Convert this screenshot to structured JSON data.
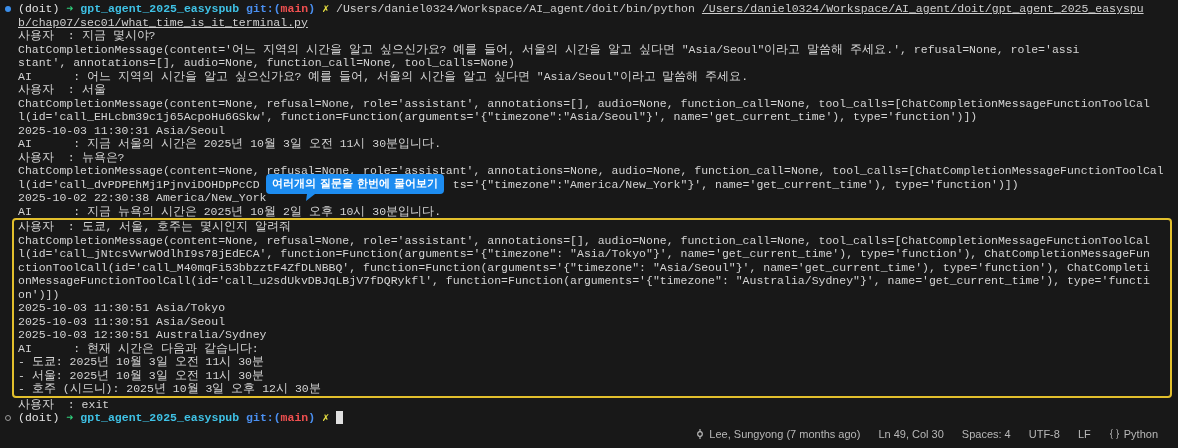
{
  "terminal": {
    "rows_before": [
      {
        "kind": "prompt",
        "status_dot_filled": true,
        "segments": [
          {
            "kind": "env",
            "text": "(doit)"
          },
          {
            "kind": "arrow",
            "text": "➜"
          },
          {
            "kind": "dir",
            "text": "gpt_agent_2025_easyspub"
          },
          {
            "kind": "git",
            "text": "git:("
          },
          {
            "kind": "branch",
            "text": "main"
          },
          {
            "kind": "git",
            "text": ")"
          },
          {
            "kind": "dirty",
            "text": "✗"
          },
          {
            "kind": "path",
            "text": "/Users/daniel0324/Workspace/AI_agent/doit/bin/python"
          },
          {
            "kind": "link",
            "text": "/Users/daniel0324/Workspace/AI_agent/doit/gpt_agent_2025_easyspu"
          }
        ]
      },
      {
        "kind": "text",
        "segments": [
          {
            "kind": "link",
            "text": "b/chap07/sec01/what_time_is_it_terminal.py"
          }
        ]
      },
      {
        "kind": "text",
        "text": "사용자  : 지금 몇시야?"
      },
      {
        "kind": "text",
        "text": "ChatCompletionMessage(content='어느 지역의 시간을 알고 싶으신가요? 예를 들어, 서울의 시간을 알고 싶다면 \"Asia/Seoul\"이라고 말씀해 주세요.', refusal=None, role='assi"
      },
      {
        "kind": "text",
        "text": "stant', annotations=[], audio=None, function_call=None, tool_calls=None)"
      },
      {
        "kind": "text",
        "text": "AI      : 어느 지역의 시간을 알고 싶으신가요? 예를 들어, 서울의 시간을 알고 싶다면 \"Asia/Seoul\"이라고 말씀해 주세요."
      },
      {
        "kind": "text",
        "text": "사용자  : 서울"
      },
      {
        "kind": "text",
        "text": "ChatCompletionMessage(content=None, refusal=None, role='assistant', annotations=[], audio=None, function_call=None, tool_calls=[ChatCompletionMessageFunctionToolCal"
      },
      {
        "kind": "text",
        "text": "l(id='call_EHLcbm39c1j65AcpoHu6GSkw', function=Function(arguments='{\"timezone\":\"Asia/Seoul\"}', name='get_current_time'), type='function')])"
      },
      {
        "kind": "text",
        "text": "2025-10-03 11:30:31 Asia/Seoul"
      },
      {
        "kind": "text",
        "text": "AI      : 지금 서울의 시간은 2025년 10월 3일 오전 11시 30분입니다."
      },
      {
        "kind": "text",
        "text": "사용자  : 뉴욕은?"
      },
      {
        "kind": "text",
        "text": "ChatCompletionMessage(content=None, refusal=None, role='assistant', annotations=None, audio=None, function_call=None, tool_calls=[ChatCompletionMessageFunctionToolCal"
      },
      {
        "kind": "split",
        "left": "l(id='call_dvPDPEhMj1PjnviDOHDpPcCD",
        "right": "ts='{\"timezone\":\"America/New_York\"}', name='get_current_time'), type='function')])"
      },
      {
        "kind": "text",
        "text": "2025-10-02 22:30:38 America/New_York"
      },
      {
        "kind": "text",
        "text": "AI      : 지금 뉴욕의 시간은 2025년 10월 2일 오후 10시 30분입니다."
      }
    ],
    "highlight_box": {
      "rows": [
        {
          "kind": "text",
          "text": "사용자  : 도쿄, 서울, 호주는 몇시인지 알려줘"
        },
        {
          "kind": "text",
          "text": "ChatCompletionMessage(content=None, refusal=None, role='assistant', annotations=[], audio=None, function_call=None, tool_calls=[ChatCompletionMessageFunctionToolCal"
        },
        {
          "kind": "text",
          "text": "l(id='call_jNtcsVwrWOdlhI9s78jEdECA', function=Function(arguments='{\"timezone\": \"Asia/Tokyo\"}', name='get_current_time'), type='function'), ChatCompletionMessageFun"
        },
        {
          "kind": "text",
          "text": "ctionToolCall(id='call_M40mqFi53bbzztF4ZfDLNBBQ', function=Function(arguments='{\"timezone\": \"Asia/Seoul\"}', name='get_current_time'), type='function'), ChatCompleti"
        },
        {
          "kind": "text",
          "text": "onMessageFunctionToolCall(id='call_u2sdUkvDBJqLBjV7fDQRykfl', function=Function(arguments='{\"timezone\": \"Australia/Sydney\"}', name='get_current_time'), type='functi"
        },
        {
          "kind": "text",
          "text": "on')])"
        },
        {
          "kind": "text",
          "text": "2025-10-03 11:30:51 Asia/Tokyo"
        },
        {
          "kind": "text",
          "text": "2025-10-03 11:30:51 Asia/Seoul"
        },
        {
          "kind": "text",
          "text": "2025-10-03 12:30:51 Australia/Sydney"
        },
        {
          "kind": "text",
          "text": "AI      : 현재 시간은 다음과 같습니다:"
        },
        {
          "kind": "text",
          "text": "- 도쿄: 2025년 10월 3일 오전 11시 30분"
        },
        {
          "kind": "text",
          "text": "- 서울: 2025년 10월 3일 오전 11시 30분"
        },
        {
          "kind": "text",
          "text": "- 호주 (시드니): 2025년 10월 3일 오후 12시 30분"
        }
      ]
    },
    "rows_after": [
      {
        "kind": "text",
        "text": "사용자  : exit"
      },
      {
        "kind": "prompt",
        "status_dot_filled": false,
        "cursor": true,
        "segments": [
          {
            "kind": "env",
            "text": "(doit)"
          },
          {
            "kind": "arrow",
            "text": "➜"
          },
          {
            "kind": "dir",
            "text": "gpt_agent_2025_easyspub"
          },
          {
            "kind": "git",
            "text": "git:("
          },
          {
            "kind": "branch",
            "text": "main"
          },
          {
            "kind": "git",
            "text": ")"
          },
          {
            "kind": "dirty",
            "text": "✗"
          }
        ]
      }
    ]
  },
  "callout": {
    "text": "여러개의 질문을 한번에 물어보기"
  },
  "status_bar": {
    "items": [
      {
        "kind": "blame",
        "text": "Lee, Sungyong (7 months ago)"
      },
      {
        "kind": "text",
        "text": "Ln 49, Col 30"
      },
      {
        "kind": "text",
        "text": "Spaces: 4"
      },
      {
        "kind": "text",
        "text": "UTF-8"
      },
      {
        "kind": "text",
        "text": "LF"
      },
      {
        "kind": "language",
        "text": "Python"
      }
    ]
  }
}
